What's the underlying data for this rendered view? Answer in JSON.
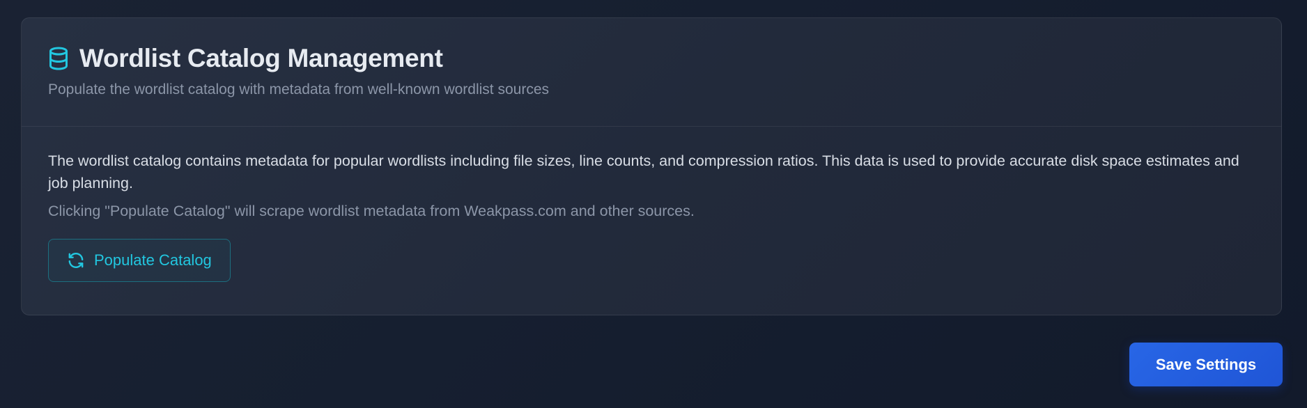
{
  "card": {
    "title": "Wordlist Catalog Management",
    "subtitle": "Populate the wordlist catalog with metadata from well-known wordlist sources",
    "title_icon": "database-icon",
    "description": "The wordlist catalog contains metadata for popular wordlists including file sizes, line counts, and compression ratios. This data is used to provide accurate disk space estimates and job planning.",
    "note": "Clicking \"Populate Catalog\" will scrape wordlist metadata from Weakpass.com and other sources.",
    "populate_button": {
      "label": "Populate Catalog",
      "icon": "refresh-icon"
    }
  },
  "footer": {
    "save_label": "Save Settings"
  },
  "colors": {
    "accent_cyan": "#22c7e0",
    "primary_blue": "#2563eb",
    "background": "#161f30"
  }
}
